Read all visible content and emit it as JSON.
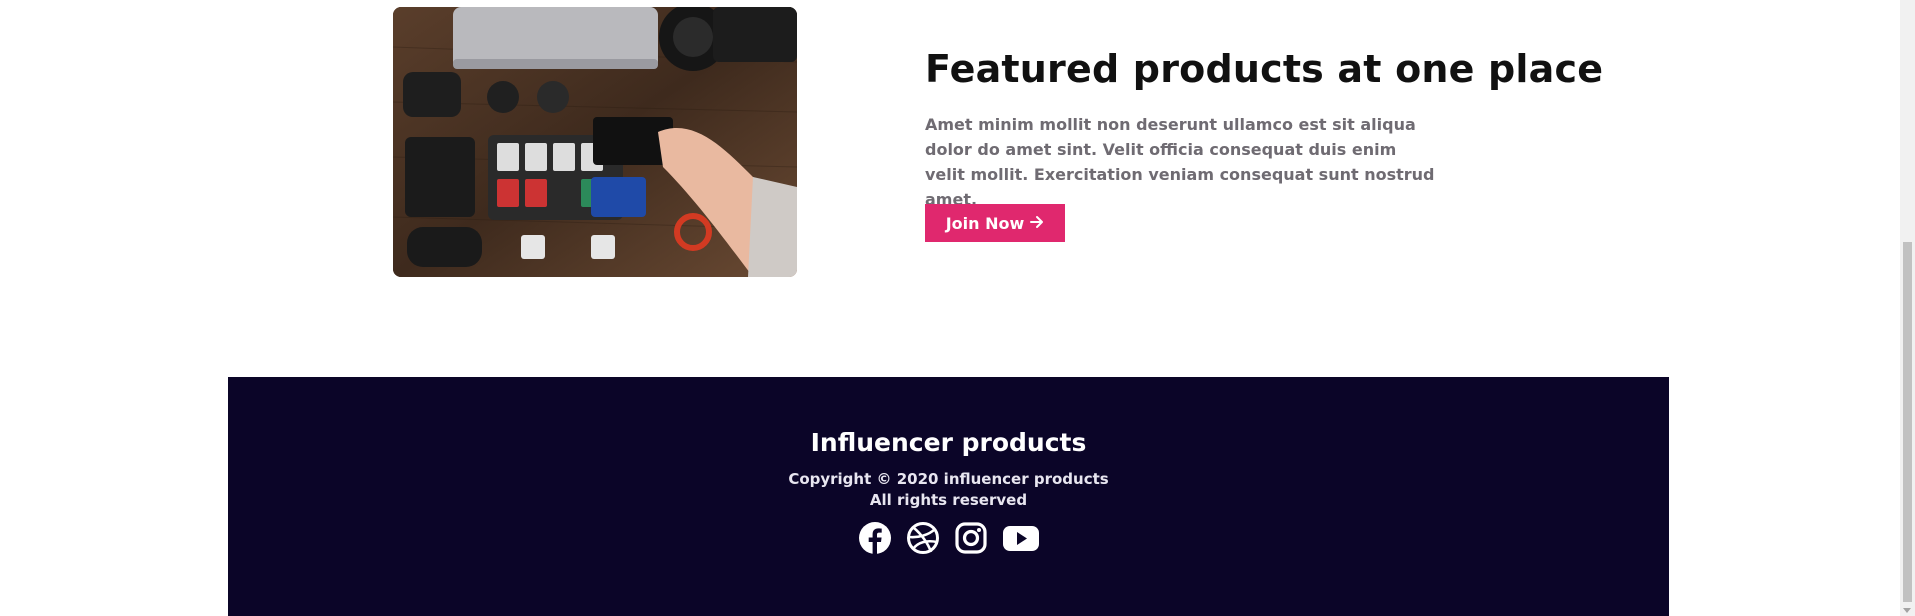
{
  "featured": {
    "image_alt": "Flat lay of camera gear, memory cards and a portable SSD on a wooden desk",
    "title": "Featured products at one place",
    "description": "Amet minim mollit non deserunt ullamco est sit aliqua dolor do amet sint. Velit officia consequat duis enim velit mollit. Exercitation veniam consequat sunt nostrud amet.",
    "button_label": "Join Now",
    "button_icon": "arrow-right-icon",
    "accent_color": "#e0286e"
  },
  "footer": {
    "title": "Influencer products",
    "copyright_line1": "Copyright © 2020 influencer products",
    "copyright_line2": "All rights reserved",
    "background_color": "#0b0528",
    "social": [
      {
        "icon": "facebook-icon"
      },
      {
        "icon": "dribbble-icon"
      },
      {
        "icon": "instagram-icon"
      },
      {
        "icon": "youtube-icon"
      }
    ]
  }
}
